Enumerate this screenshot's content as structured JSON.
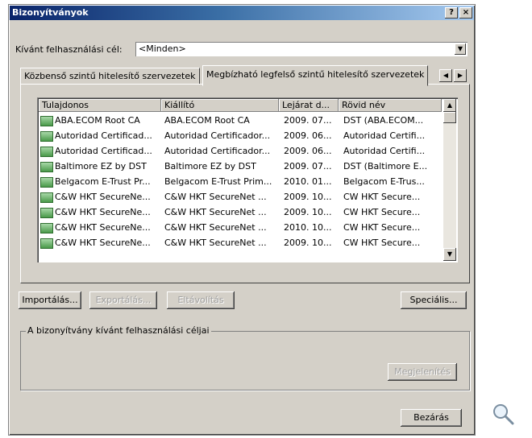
{
  "window": {
    "title": "Bizonyítványok",
    "help": "?",
    "close": "×"
  },
  "purpose": {
    "label": "Kívánt felhasználási cél:",
    "value": "<Minden>"
  },
  "tabs": [
    {
      "label": "Közbenső szintű hitelesítő szervezetek",
      "active": false
    },
    {
      "label": "Megbízható legfelső szintű hitelesítő szervezetek",
      "active": true
    }
  ],
  "list": {
    "columns": [
      "Tulajdonos",
      "Kiállító",
      "Lejárat d...",
      "Rövid név"
    ],
    "rows": [
      [
        "ABA.ECOM Root CA",
        "ABA.ECOM Root CA",
        "2009. 07...",
        "DST (ABA.ECOM..."
      ],
      [
        "Autoridad Certificad...",
        "Autoridad Certificador...",
        "2009. 06...",
        "Autoridad Certifi..."
      ],
      [
        "Autoridad Certificad...",
        "Autoridad Certificador...",
        "2009. 06...",
        "Autoridad Certifi..."
      ],
      [
        "Baltimore EZ by DST",
        "Baltimore EZ by DST",
        "2009. 07...",
        "DST (Baltimore E..."
      ],
      [
        "Belgacom E-Trust Pr...",
        "Belgacom E-Trust Prim...",
        "2010. 01...",
        "Belgacom E-Trus..."
      ],
      [
        "C&W HKT SecureNe...",
        "C&W HKT SecureNet ...",
        "2009. 10...",
        "CW HKT Secure..."
      ],
      [
        "C&W HKT SecureNe...",
        "C&W HKT SecureNet ...",
        "2009. 10...",
        "CW HKT Secure..."
      ],
      [
        "C&W HKT SecureNe...",
        "C&W HKT SecureNet ...",
        "2010. 10...",
        "CW HKT Secure..."
      ],
      [
        "C&W HKT SecureNe...",
        "C&W HKT SecureNet ...",
        "2009. 10...",
        "CW HKT Secure..."
      ]
    ]
  },
  "buttons": {
    "import": "Importálás...",
    "export": "Exportálás...",
    "remove": "Eltávolítás",
    "advanced": "Speciális...",
    "view": "Megjelenítés",
    "close": "Bezárás"
  },
  "purposes_group": {
    "label": "A bizonyítvány kívánt felhasználási céljai"
  },
  "icons": {
    "magnifier": "magnifier-icon",
    "certificate": "certificate-icon"
  }
}
